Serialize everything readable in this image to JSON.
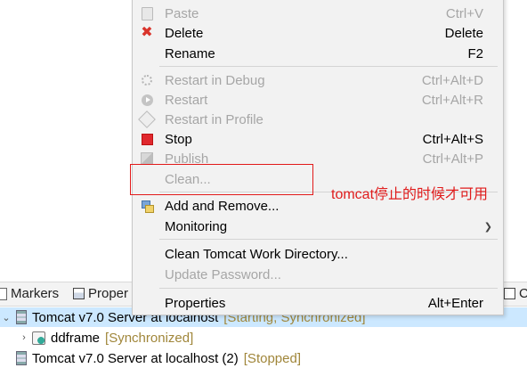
{
  "context_menu": {
    "items": [
      {
        "label": "Paste",
        "shortcut": "Ctrl+V",
        "icon": "paste-icon",
        "enabled": false
      },
      {
        "label": "Delete",
        "shortcut": "Delete",
        "icon": "delete-icon",
        "enabled": true
      },
      {
        "label": "Rename",
        "shortcut": "F2",
        "icon": "",
        "enabled": true
      },
      {
        "label": "Restart in Debug",
        "shortcut": "Ctrl+Alt+D",
        "icon": "debug-icon",
        "enabled": false
      },
      {
        "label": "Restart",
        "shortcut": "Ctrl+Alt+R",
        "icon": "restart-icon",
        "enabled": false
      },
      {
        "label": "Restart in Profile",
        "shortcut": "",
        "icon": "profile-icon",
        "enabled": false
      },
      {
        "label": "Stop",
        "shortcut": "Ctrl+Alt+S",
        "icon": "stop-icon",
        "enabled": true
      },
      {
        "label": "Publish",
        "shortcut": "Ctrl+Alt+P",
        "icon": "publish-icon",
        "enabled": false
      },
      {
        "label": "Clean...",
        "shortcut": "",
        "icon": "",
        "enabled": false
      },
      {
        "label": "Add and Remove...",
        "shortcut": "",
        "icon": "add-remove-icon",
        "enabled": true
      },
      {
        "label": "Monitoring",
        "shortcut": "",
        "icon": "",
        "enabled": true,
        "submenu": true
      },
      {
        "label": "Clean Tomcat Work Directory...",
        "shortcut": "",
        "icon": "",
        "enabled": true
      },
      {
        "label": "Update Password...",
        "shortcut": "",
        "icon": "",
        "enabled": false
      },
      {
        "label": "Properties",
        "shortcut": "Alt+Enter",
        "icon": "",
        "enabled": true
      }
    ]
  },
  "views": {
    "tabs": [
      {
        "label": "Markers",
        "icon": "markers-icon"
      },
      {
        "label": "Proper",
        "icon": "properties-icon"
      },
      {
        "label": "C",
        "icon": "console-icon"
      }
    ]
  },
  "servers": {
    "rows": [
      {
        "name": "Tomcat v7.0 Server at localhost",
        "status": "[Starting, Synchronized]",
        "expanded": true,
        "selected": true
      },
      {
        "name": "ddframe",
        "status": "[Synchronized]",
        "expanded": false,
        "selected": false
      },
      {
        "name": "Tomcat v7.0 Server at localhost (2)",
        "status": "[Stopped]",
        "expanded": false,
        "selected": false
      }
    ]
  },
  "annotation": {
    "note": "tomcat停止的时候才可用",
    "color": "#e21a1a"
  },
  "colors": {
    "selection": "#cce8ff",
    "status_text": "#a0863a",
    "disabled_text": "#a6a6a6"
  }
}
